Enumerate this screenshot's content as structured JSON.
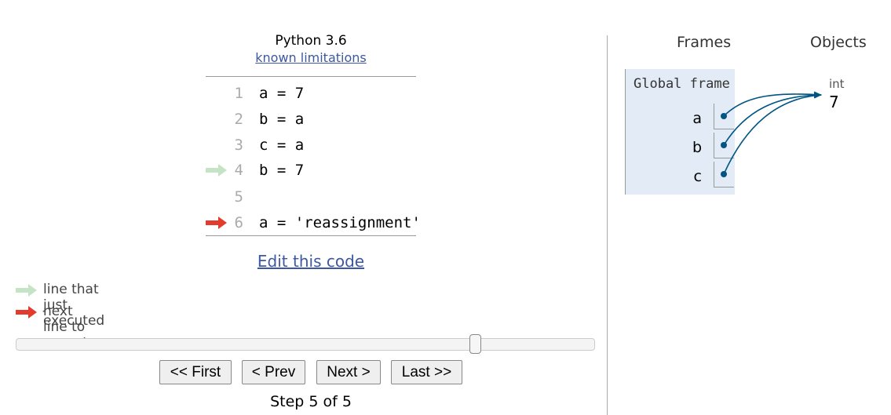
{
  "header": {
    "language": "Python 3.6",
    "limitations_link": "known limitations"
  },
  "code": {
    "lines": [
      {
        "number": "1",
        "text": "a = 7"
      },
      {
        "number": "2",
        "text": "b = a"
      },
      {
        "number": "3",
        "text": "c = a"
      },
      {
        "number": "4",
        "text": "b = 7"
      },
      {
        "number": "5",
        "text": ""
      },
      {
        "number": "6",
        "text": "a = 'reassignment'"
      }
    ],
    "edit_link": "Edit this code"
  },
  "legend": {
    "executed": "line that just executed",
    "next": "next line to execute"
  },
  "navigation": {
    "first": "<< First",
    "prev": "< Prev",
    "next": "Next >",
    "last": "Last >>",
    "step_text": "Step 5 of 5"
  },
  "slider": {
    "current_step": 5,
    "total_steps": 5
  },
  "visualization": {
    "frames_header": "Frames",
    "objects_header": "Objects",
    "frame_title": "Global frame",
    "variables": [
      "a",
      "b",
      "c"
    ],
    "object": {
      "type": "int",
      "value": "7"
    }
  },
  "colors": {
    "executed_arrow": "#c5e3c5",
    "next_arrow": "#e33c2e",
    "pointer": "#005583",
    "frame_bg": "#e2ebf6",
    "link": "#3d58a2"
  }
}
